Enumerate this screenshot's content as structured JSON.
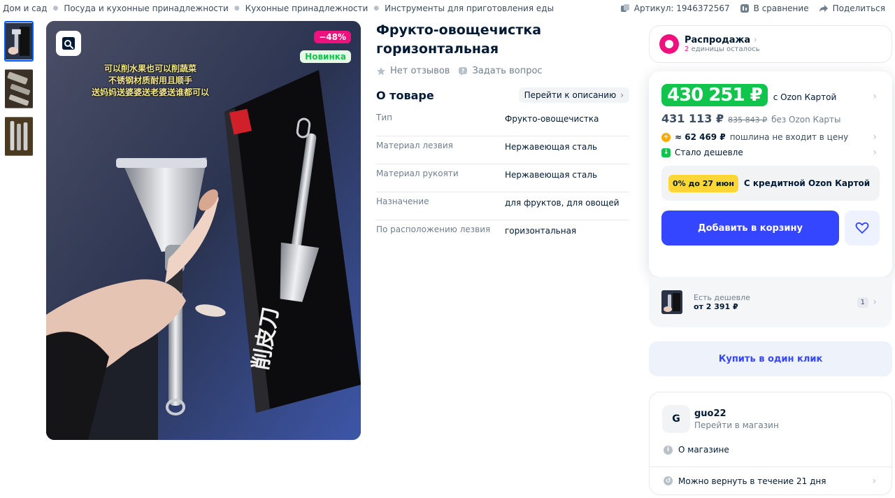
{
  "breadcrumbs": [
    "Дом и сад",
    "Посуда и кухонные принадлежности",
    "Кухонные принадлежности",
    "Инструменты для приготовления еды"
  ],
  "top_actions": {
    "article": "Артикул: 1946372567",
    "compare": "В сравнение",
    "share": "Поделиться"
  },
  "gallery": {
    "discount_badge": "−48%",
    "new_badge": "Новинка",
    "overlay_text": [
      "可以削水果也可以削蔬菜",
      "不锈钢材质耐用且顺手",
      "送妈妈送婆婆送老婆送谁都可以"
    ]
  },
  "product": {
    "title": "Фрукто-овощечистка горизонтальная",
    "reviews": "Нет отзывов",
    "ask": "Задать вопрос",
    "about_title": "О товаре",
    "goto_description": "Перейти к описанию",
    "specs": [
      {
        "k": "Тип",
        "v": "Фрукто-овощечистка"
      },
      {
        "k": "Материал лезвия",
        "v": "Нержавеющая сталь"
      },
      {
        "k": "Материал рукояти",
        "v": "Нержавеющая сталь"
      },
      {
        "k": "Назначение",
        "v": "для фруктов, для овощей"
      },
      {
        "k": "По расположению лезвия",
        "v": "горизонтальная"
      }
    ]
  },
  "sale": {
    "title": "Распродажа",
    "count": "2",
    "remaining": "единицы осталось"
  },
  "price": {
    "card_price": "430 251 ₽",
    "card_note": "с Ozon Картой",
    "regular_price": "431 113 ₽",
    "old_price": "835 843 ₽",
    "regular_note": "без Ozon Карты",
    "duty_value": "≈ 62 469 ₽",
    "duty_note": "пошлина не входит в цену",
    "cheaper": "Стало дешевле",
    "credit_tag": "0% до 27 июн",
    "credit_text": "С кредитной Ozon Картой",
    "add_to_cart": "Добавить в корзину"
  },
  "cheaper_offer": {
    "label": "Есть дешевле",
    "price": "от 2 391 ₽",
    "count": "1"
  },
  "one_click": "Купить в один клик",
  "seller": {
    "avatar_letter": "G",
    "name": "guo22",
    "link": "Перейти в магазин",
    "about": "О магазине",
    "return_text": "Можно вернуть в течение 21 дня"
  },
  "colors": {
    "accent": "#005bff",
    "price_green": "#10c44c",
    "cart_blue": "#3446ff",
    "discount_pink": "#f1117e"
  }
}
